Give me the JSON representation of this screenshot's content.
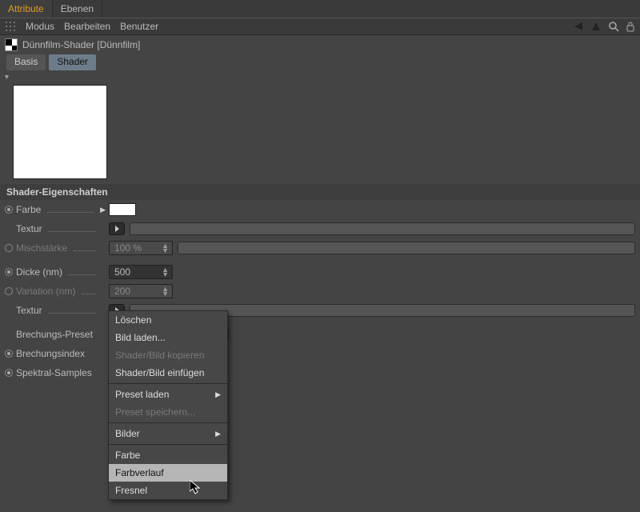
{
  "topTabs": {
    "attribute": "Attribute",
    "ebenen": "Ebenen"
  },
  "menubar": {
    "modus": "Modus",
    "bearbeiten": "Bearbeiten",
    "benutzer": "Benutzer"
  },
  "objectTitle": "Dünnfilm-Shader [Dünnfilm]",
  "subtabs": {
    "basis": "Basis",
    "shader": "Shader"
  },
  "section": "Shader-Eigenschaften",
  "props": {
    "farbe": "Farbe",
    "textur": "Textur",
    "mischstaerke": "Mischstärke",
    "misch_val": "100 %",
    "dicke": "Dicke (nm)",
    "dicke_val": "500",
    "variation": "Variation (nm)",
    "variation_val": "200",
    "brechungs_preset": "Brechungs-Preset",
    "brechungsindex": "Brechungsindex",
    "spektral": "Spektral-Samples"
  },
  "ctx": {
    "loeschen": "Löschen",
    "bild_laden": "Bild laden...",
    "shader_kopieren": "Shader/Bild kopieren",
    "shader_einfuegen": "Shader/Bild einfügen",
    "preset_laden": "Preset laden",
    "preset_speichern": "Preset speichern...",
    "bilder": "Bilder",
    "farbe": "Farbe",
    "farbverlauf": "Farbverlauf",
    "fresnel": "Fresnel"
  }
}
